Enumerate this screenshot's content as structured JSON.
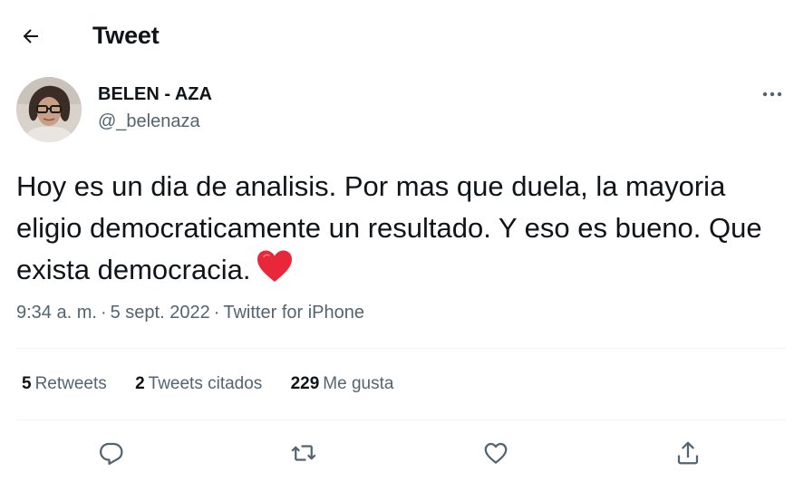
{
  "header": {
    "title": "Tweet",
    "back_icon": "arrow-left-icon"
  },
  "author": {
    "name": "BELEN - AZA",
    "handle": "@_belenaza"
  },
  "tweet": {
    "text": "Hoy es un dia de analisis. Por mas que duela, la mayoria eligio democraticamente un resultado. Y eso es bueno. Que exista democracia.",
    "emoji": "red-heart-icon",
    "time": "9:34 a. m.",
    "date": "5 sept. 2022",
    "source": "Twitter for iPhone",
    "separator": "·"
  },
  "stats": [
    {
      "count": "5",
      "label": "Retweets"
    },
    {
      "count": "2",
      "label": "Tweets citados"
    },
    {
      "count": "229",
      "label": "Me gusta"
    }
  ],
  "actions": [
    "reply-icon",
    "retweet-icon",
    "like-icon",
    "share-icon"
  ],
  "colors": {
    "text": "#0f1419",
    "secondary": "#536471",
    "divider": "#eff3f4",
    "heart": "#e8283a"
  }
}
